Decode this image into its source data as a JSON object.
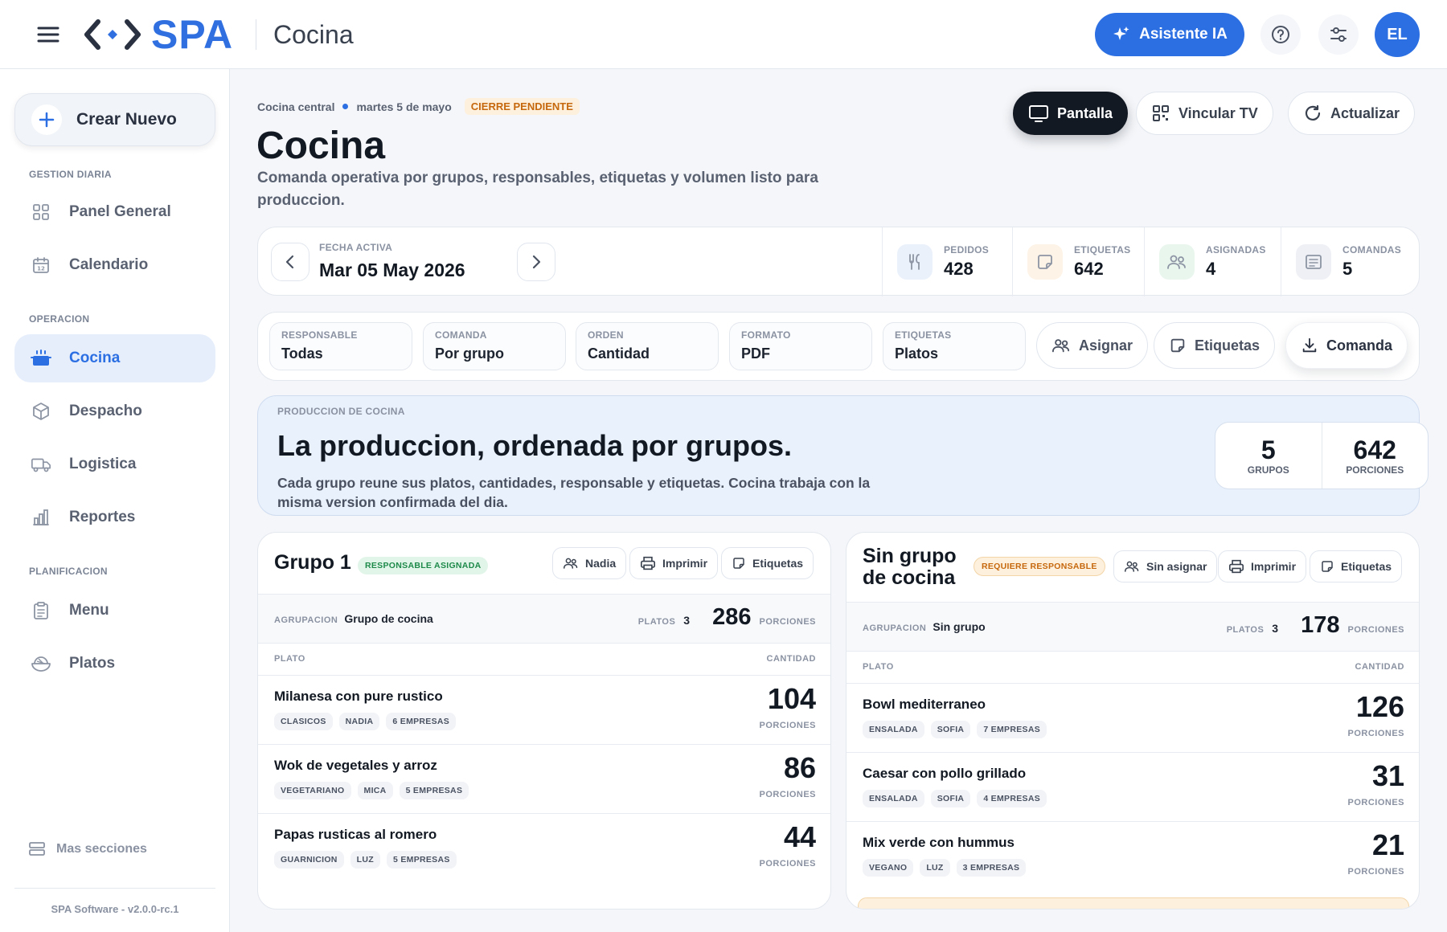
{
  "topbar": {
    "logo_text": "SPA",
    "title": "Cocina",
    "ai_button": "Asistente IA",
    "avatar": "EL",
    "brand_color": "#2c6fe3"
  },
  "sidebar": {
    "create_button": "Crear Nuevo",
    "sections": {
      "gestion": "GESTION DIARIA",
      "operacion": "OPERACION",
      "planificacion": "PLANIFICACION"
    },
    "items": {
      "panel": "Panel General",
      "calendario": "Calendario",
      "cocina": "Cocina",
      "despacho": "Despacho",
      "logistica": "Logistica",
      "reportes": "Reportes",
      "menu": "Menu",
      "platos": "Platos"
    },
    "more": "Mas secciones",
    "version": "SPA Software - v2.0.0-rc.1"
  },
  "header": {
    "crumb_location": "Cocina central",
    "crumb_date": "martes 5 de mayo",
    "status": "CIERRE PENDIENTE",
    "title": "Cocina",
    "subtitle": "Comanda operativa por grupos, responsables, etiquetas y volumen listo para produccion.",
    "btn_pantalla": "Pantalla",
    "btn_vincular": "Vincular TV",
    "btn_actualizar": "Actualizar"
  },
  "datebar": {
    "label": "FECHA ACTIVA",
    "value": "Mar 05 May 2026",
    "stats": {
      "pedidos": {
        "label": "PEDIDOS",
        "value": "428"
      },
      "etiquetas": {
        "label": "ETIQUETAS",
        "value": "642"
      },
      "asignadas": {
        "label": "ASIGNADAS",
        "value": "4"
      },
      "comandas": {
        "label": "COMANDAS",
        "value": "5"
      }
    }
  },
  "filters": {
    "responsable": {
      "label": "RESPONSABLE",
      "value": "Todas"
    },
    "comanda": {
      "label": "COMANDA",
      "value": "Por grupo"
    },
    "orden": {
      "label": "ORDEN",
      "value": "Cantidad"
    },
    "formato": {
      "label": "FORMATO",
      "value": "PDF"
    },
    "etiquetas": {
      "label": "ETIQUETAS",
      "value": "Platos"
    },
    "btn_asignar": "Asignar",
    "btn_etiquetas": "Etiquetas",
    "btn_comanda": "Comanda"
  },
  "banner": {
    "eyebrow": "PRODUCCION DE COCINA",
    "title": "La produccion, ordenada por grupos.",
    "text": "Cada grupo reune sus platos, cantidades, responsable y etiquetas. Cocina trabaja con la misma version confirmada del dia.",
    "grupos": {
      "value": "5",
      "label": "GRUPOS"
    },
    "porciones": {
      "value": "642",
      "label": "PORCIONES"
    }
  },
  "group1": {
    "title": "Grupo 1",
    "badge": "RESPONSABLE ASIGNADA",
    "btn_person": "Nadia",
    "btn_print": "Imprimir",
    "btn_labels": "Etiquetas",
    "agrupacion_label": "AGRUPACION",
    "agrupacion_value": "Grupo de cocina",
    "platos_label": "PLATOS",
    "platos_value": "3",
    "total": "286",
    "total_unit": "PORCIONES",
    "col_plato": "PLATO",
    "col_cantidad": "CANTIDAD",
    "rows": [
      {
        "name": "Milanesa con pure rustico",
        "tags": [
          "CLASICOS",
          "NADIA",
          "6 EMPRESAS"
        ],
        "qty": "104",
        "unit": "PORCIONES"
      },
      {
        "name": "Wok de vegetales y arroz",
        "tags": [
          "VEGETARIANO",
          "MICA",
          "5 EMPRESAS"
        ],
        "qty": "86",
        "unit": "PORCIONES"
      },
      {
        "name": "Papas rusticas al romero",
        "tags": [
          "GUARNICION",
          "LUZ",
          "5 EMPRESAS"
        ],
        "qty": "44",
        "unit": "PORCIONES"
      }
    ]
  },
  "group2": {
    "title_line1": "Sin grupo",
    "title_line2": "de cocina",
    "badge": "REQUIERE RESPONSABLE",
    "btn_person": "Sin asignar",
    "btn_print": "Imprimir",
    "btn_labels": "Etiquetas",
    "agrupacion_label": "AGRUPACION",
    "agrupacion_value": "Sin grupo",
    "platos_label": "PLATOS",
    "platos_value": "3",
    "total": "178",
    "total_unit": "PORCIONES",
    "col_plato": "PLATO",
    "col_cantidad": "CANTIDAD",
    "rows": [
      {
        "name": "Bowl mediterraneo",
        "tags": [
          "ENSALADA",
          "SOFIA",
          "7 EMPRESAS"
        ],
        "qty": "126",
        "unit": "PORCIONES"
      },
      {
        "name": "Caesar con pollo grillado",
        "tags": [
          "ENSALADA",
          "SOFIA",
          "4 EMPRESAS"
        ],
        "qty": "31",
        "unit": "PORCIONES"
      },
      {
        "name": "Mix verde con hummus",
        "tags": [
          "VEGANO",
          "LUZ",
          "3 EMPRESAS"
        ],
        "qty": "21",
        "unit": "PORCIONES"
      }
    ]
  }
}
